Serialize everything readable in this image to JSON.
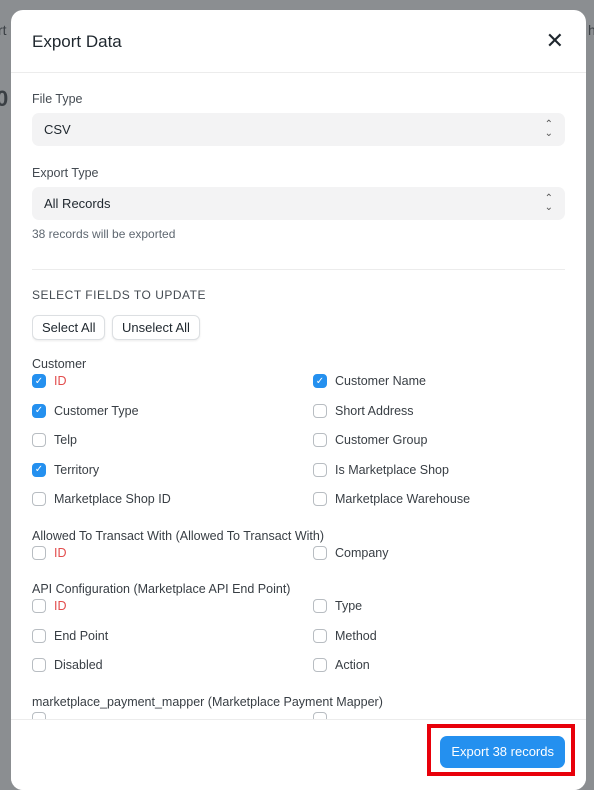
{
  "dialog": {
    "title": "Export Data",
    "close_icon": "close-icon"
  },
  "file_type": {
    "label": "File Type",
    "value": "CSV"
  },
  "export_type": {
    "label": "Export Type",
    "value": "All Records",
    "note": "38 records will be exported"
  },
  "fields": {
    "heading": "SELECT FIELDS TO UPDATE",
    "select_all": "Select All",
    "unselect_all": "Unselect All",
    "groups": [
      {
        "title": "Customer",
        "items": [
          {
            "label": "ID",
            "checked": true,
            "required": true
          },
          {
            "label": "Customer Name",
            "checked": true
          },
          {
            "label": "Customer Type",
            "checked": true
          },
          {
            "label": "Short Address",
            "checked": false
          },
          {
            "label": "Telp",
            "checked": false
          },
          {
            "label": "Customer Group",
            "checked": false
          },
          {
            "label": "Territory",
            "checked": true
          },
          {
            "label": "Is Marketplace Shop",
            "checked": false
          },
          {
            "label": "Marketplace Shop ID",
            "checked": false
          },
          {
            "label": "Marketplace Warehouse",
            "checked": false
          }
        ]
      },
      {
        "title": "Allowed To Transact With (Allowed To Transact With)",
        "items": [
          {
            "label": "ID",
            "checked": false,
            "required": true
          },
          {
            "label": "Company",
            "checked": false
          }
        ]
      },
      {
        "title": "API Configuration (Marketplace API End Point)",
        "items": [
          {
            "label": "ID",
            "checked": false,
            "required": true
          },
          {
            "label": "Type",
            "checked": false
          },
          {
            "label": "End Point",
            "checked": false
          },
          {
            "label": "Method",
            "checked": false
          },
          {
            "label": "Disabled",
            "checked": false
          },
          {
            "label": "Action",
            "checked": false
          }
        ]
      },
      {
        "title": "marketplace_payment_mapper (Marketplace Payment Mapper)",
        "items": [
          {
            "label": "",
            "checked": false
          },
          {
            "label": "",
            "checked": false
          }
        ]
      }
    ]
  },
  "footer": {
    "export_button": "Export 38 records"
  },
  "colors": {
    "primary": "#2490ef",
    "required": "#e24c4c",
    "highlight": "#e8000a"
  }
}
